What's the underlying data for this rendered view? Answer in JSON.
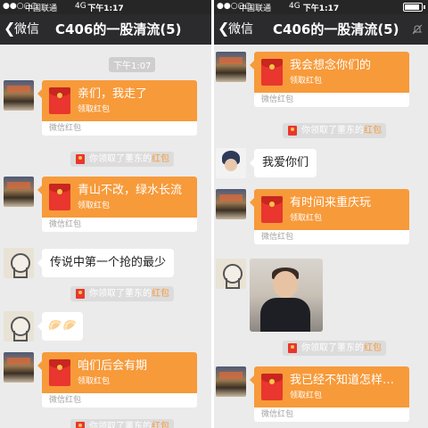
{
  "status": {
    "signal": "●●○○○",
    "carrier": "中国联通",
    "network": "4G",
    "time": "下午1:17"
  },
  "nav": {
    "back_label": "微信",
    "chat_title": "C406的一股清流(5)"
  },
  "packet": {
    "sub_label": "领取红包",
    "footer_label": "微信红包"
  },
  "system": {
    "claim_prefix": "你领取了董东的",
    "claim_highlight": "红包"
  },
  "left": {
    "timestamp": "下午1:07",
    "messages": [
      {
        "type": "packet",
        "text": "亲们，我走了"
      },
      {
        "type": "system"
      },
      {
        "type": "packet",
        "text": "青山不改，绿水长流"
      },
      {
        "type": "text",
        "text": "传说中第一个抢的最少"
      },
      {
        "type": "system"
      },
      {
        "type": "emoji",
        "text": "🥟🥟"
      },
      {
        "type": "packet",
        "text": "咱们后会有期"
      },
      {
        "type": "system"
      }
    ]
  },
  "right": {
    "messages": [
      {
        "type": "packet",
        "text": "我会想念你们的"
      },
      {
        "type": "system"
      },
      {
        "type": "text",
        "text": "我爱你们"
      },
      {
        "type": "packet",
        "text": "有时间来重庆玩"
      },
      {
        "type": "image",
        "text": ""
      },
      {
        "type": "system"
      },
      {
        "type": "packet",
        "text": "我已经不知道怎样…"
      }
    ]
  },
  "icons": {
    "back": "chevron-left-icon",
    "mute": "mute-icon",
    "red_packet": "red-envelope-icon"
  },
  "colors": {
    "status_bar": "#262626",
    "nav_bar": "#2b2b2e",
    "chat_bg": "#ebebeb",
    "packet_orange": "#f79a3a",
    "packet_red": "#e9362e"
  }
}
